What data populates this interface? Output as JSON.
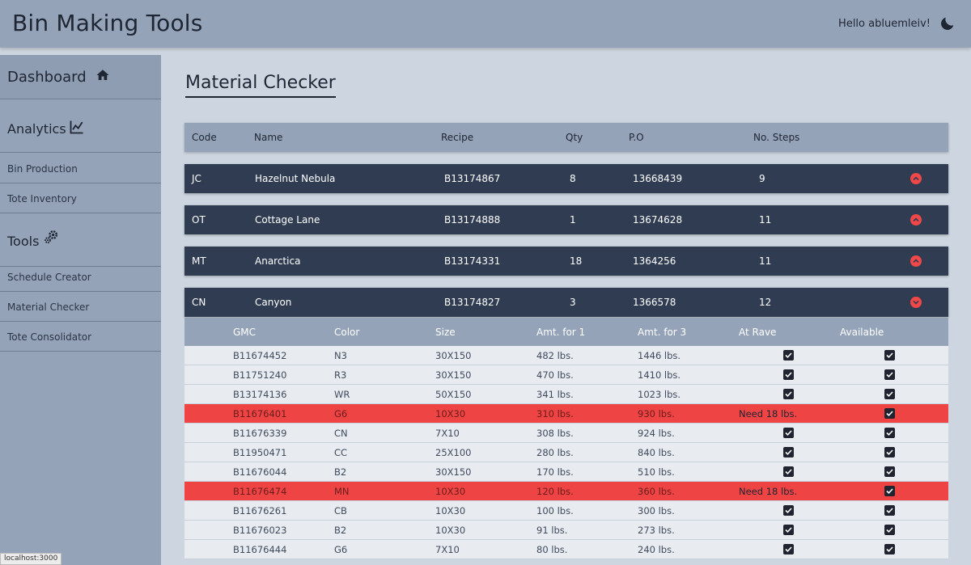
{
  "app": {
    "title": "Bin Making Tools",
    "greeting": "Hello abluemleiv!",
    "theme_icon": "moon-icon"
  },
  "sidebar": {
    "dashboard": {
      "label": "Dashboard",
      "icon": "home-icon"
    },
    "analytics": {
      "label": "Analytics",
      "icon": "chart-line-icon"
    },
    "analytics_items": [
      {
        "label": "Bin Production"
      },
      {
        "label": "Tote Inventory"
      }
    ],
    "tools": {
      "label": "Tools",
      "icon": "gears-icon"
    },
    "tools_items": [
      {
        "label": "Schedule Creator"
      },
      {
        "label": "Material Checker"
      },
      {
        "label": "Tote Consolidator"
      }
    ]
  },
  "main": {
    "title": "Material Checker",
    "columns": [
      "Code",
      "Name",
      "Recipe",
      "Qty",
      "P.O",
      "No. Steps"
    ],
    "rows": [
      {
        "code": "JC",
        "name": "Hazelnut Nebula",
        "recipe": "B13174867",
        "qty": "8",
        "po": "13668439",
        "steps": "9",
        "expanded": false
      },
      {
        "code": "OT",
        "name": "Cottage Lane",
        "recipe": "B13174888",
        "qty": "1",
        "po": "13674628",
        "steps": "11",
        "expanded": false
      },
      {
        "code": "MT",
        "name": "Anarctica",
        "recipe": "B13174331",
        "qty": "18",
        "po": "1364256",
        "steps": "11",
        "expanded": false
      },
      {
        "code": "CN",
        "name": "Canyon",
        "recipe": "B13174827",
        "qty": "3",
        "po": "1366578",
        "steps": "12",
        "expanded": true
      }
    ],
    "material_columns": [
      "GMC",
      "Color",
      "Size",
      "Amt. for 1",
      "Amt. for 3",
      "At Rave",
      "Available"
    ],
    "materials": [
      {
        "gmc": "B11674452",
        "color": "N3",
        "size": "30X150",
        "amt1": "482 lbs.",
        "amt3": "1446 lbs.",
        "at_rave": true,
        "at_rave_text": "",
        "available": true,
        "alert": false
      },
      {
        "gmc": "B11751240",
        "color": "R3",
        "size": "30X150",
        "amt1": "470 lbs.",
        "amt3": "1410 lbs.",
        "at_rave": true,
        "at_rave_text": "",
        "available": true,
        "alert": false
      },
      {
        "gmc": "B13174136",
        "color": "WR",
        "size": "50X150",
        "amt1": "341 lbs.",
        "amt3": "1023 lbs.",
        "at_rave": true,
        "at_rave_text": "",
        "available": true,
        "alert": false
      },
      {
        "gmc": "B11676401",
        "color": "G6",
        "size": "10X30",
        "amt1": "310 lbs.",
        "amt3": "930 lbs.",
        "at_rave": false,
        "at_rave_text": "Need 18 lbs.",
        "available": true,
        "alert": true
      },
      {
        "gmc": "B11676339",
        "color": "CN",
        "size": "7X10",
        "amt1": "308 lbs.",
        "amt3": "924 lbs.",
        "at_rave": true,
        "at_rave_text": "",
        "available": true,
        "alert": false
      },
      {
        "gmc": "B11950471",
        "color": "CC",
        "size": "25X100",
        "amt1": "280 lbs.",
        "amt3": "840 lbs.",
        "at_rave": true,
        "at_rave_text": "",
        "available": true,
        "alert": false
      },
      {
        "gmc": "B11676044",
        "color": "B2",
        "size": "30X150",
        "amt1": "170 lbs.",
        "amt3": "510 lbs.",
        "at_rave": true,
        "at_rave_text": "",
        "available": true,
        "alert": false
      },
      {
        "gmc": "B11676474",
        "color": "MN",
        "size": "10X30",
        "amt1": "120 lbs.",
        "amt3": "360 lbs.",
        "at_rave": false,
        "at_rave_text": "Need 18 lbs.",
        "available": true,
        "alert": true
      },
      {
        "gmc": "B11676261",
        "color": "CB",
        "size": "10X30",
        "amt1": "100 lbs.",
        "amt3": "300 lbs.",
        "at_rave": true,
        "at_rave_text": "",
        "available": true,
        "alert": false
      },
      {
        "gmc": "B11676023",
        "color": "B2",
        "size": "10X30",
        "amt1": "91 lbs.",
        "amt3": "273 lbs.",
        "at_rave": true,
        "at_rave_text": "",
        "available": true,
        "alert": false
      },
      {
        "gmc": "B11676444",
        "color": "G6",
        "size": "7X10",
        "amt1": "80 lbs.",
        "amt3": "240 lbs.",
        "at_rave": true,
        "at_rave_text": "",
        "available": true,
        "alert": false
      }
    ]
  },
  "status": {
    "url": "localhost:3000"
  },
  "colors": {
    "accent": "#f04848",
    "alert_row": "#ee4444",
    "dark_row": "#2f3c52",
    "header": "#95a3b8"
  }
}
